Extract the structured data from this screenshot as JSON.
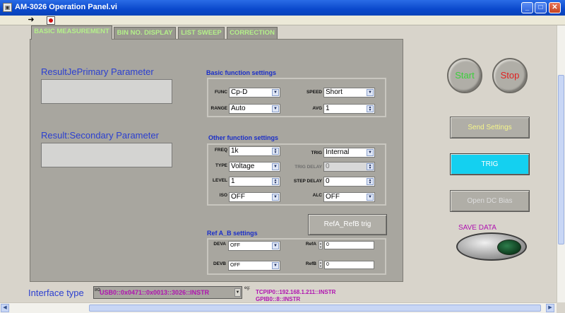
{
  "window": {
    "title": "AM-3026 Operation Panel.vi",
    "min": "_",
    "max": "□",
    "close": "✕"
  },
  "toolbar": {
    "run_icon": "run-arrow-icon",
    "stop_icon": "abort-icon"
  },
  "tabs": [
    {
      "label": "BASIC MEASUREMENT",
      "active": true
    },
    {
      "label": "BIN NO. DISPLAY",
      "active": false
    },
    {
      "label": "LIST SWEEP",
      "active": false
    },
    {
      "label": "CORRECTION",
      "active": false
    }
  ],
  "results": {
    "primary_label": "ResultJePrimary Parameter",
    "primary_value": "",
    "secondary_label": "Result:Secondary Parameter",
    "secondary_value": ""
  },
  "basic_settings": {
    "title": "Basic function settings",
    "func_label": "FUNC",
    "func_value": "Cp-D",
    "speed_label": "SPEED",
    "speed_value": "Short",
    "range_label": "RANGE",
    "range_value": "Auto",
    "avg_label": "AVG",
    "avg_value": "1"
  },
  "other_settings": {
    "title": "Other function settings",
    "freq_label": "FREQ",
    "freq_value": "1k",
    "trig_label": "TRIG",
    "trig_value": "Internal",
    "type_label": "TYPE",
    "type_value": "Voltage",
    "trig_delay_label": "TRIG DELAY",
    "trig_delay_value": "0",
    "level_label": "LEVEL",
    "level_value": "1",
    "step_delay_label": "STEP DELAY",
    "step_delay_value": "0",
    "iso_label": "ISO",
    "iso_value": "OFF",
    "alc_label": "ALC",
    "alc_value": "OFF"
  },
  "ref_settings": {
    "trig_button": "RefA_RefB trig",
    "title": "Ref A_B settings",
    "deva_label": "DEVA",
    "deva_value": "OFF",
    "devb_label": "DEVB",
    "devb_value": "OFF",
    "refa_label": "RefA",
    "refa_value": "0",
    "refb_label": "RefB",
    "refb_value": "0"
  },
  "controls": {
    "start_label": "Start",
    "stop_label": "Stop",
    "send_settings": "Send Settings",
    "trig": "TRIG",
    "open_dc_bias": "Open DC Bias",
    "save_data": "SAVE DATA"
  },
  "interface": {
    "label": "Interface type",
    "io_prefix": "I/O",
    "value": "USB0::0x0471::0x0013::3026::INSTR",
    "eg_label": "eg:",
    "example1": "TCPIP0::192.168.1.211::INSTR",
    "example2": "GPIB0::8::INSTR"
  },
  "colors": {
    "titlebar": "#0a48cc",
    "panel": "#a8a69f",
    "label_blue": "#2b3fd0",
    "tab_text": "#b4f08a",
    "trig_cyan": "#14d0f0",
    "magenta": "#b012b0"
  }
}
